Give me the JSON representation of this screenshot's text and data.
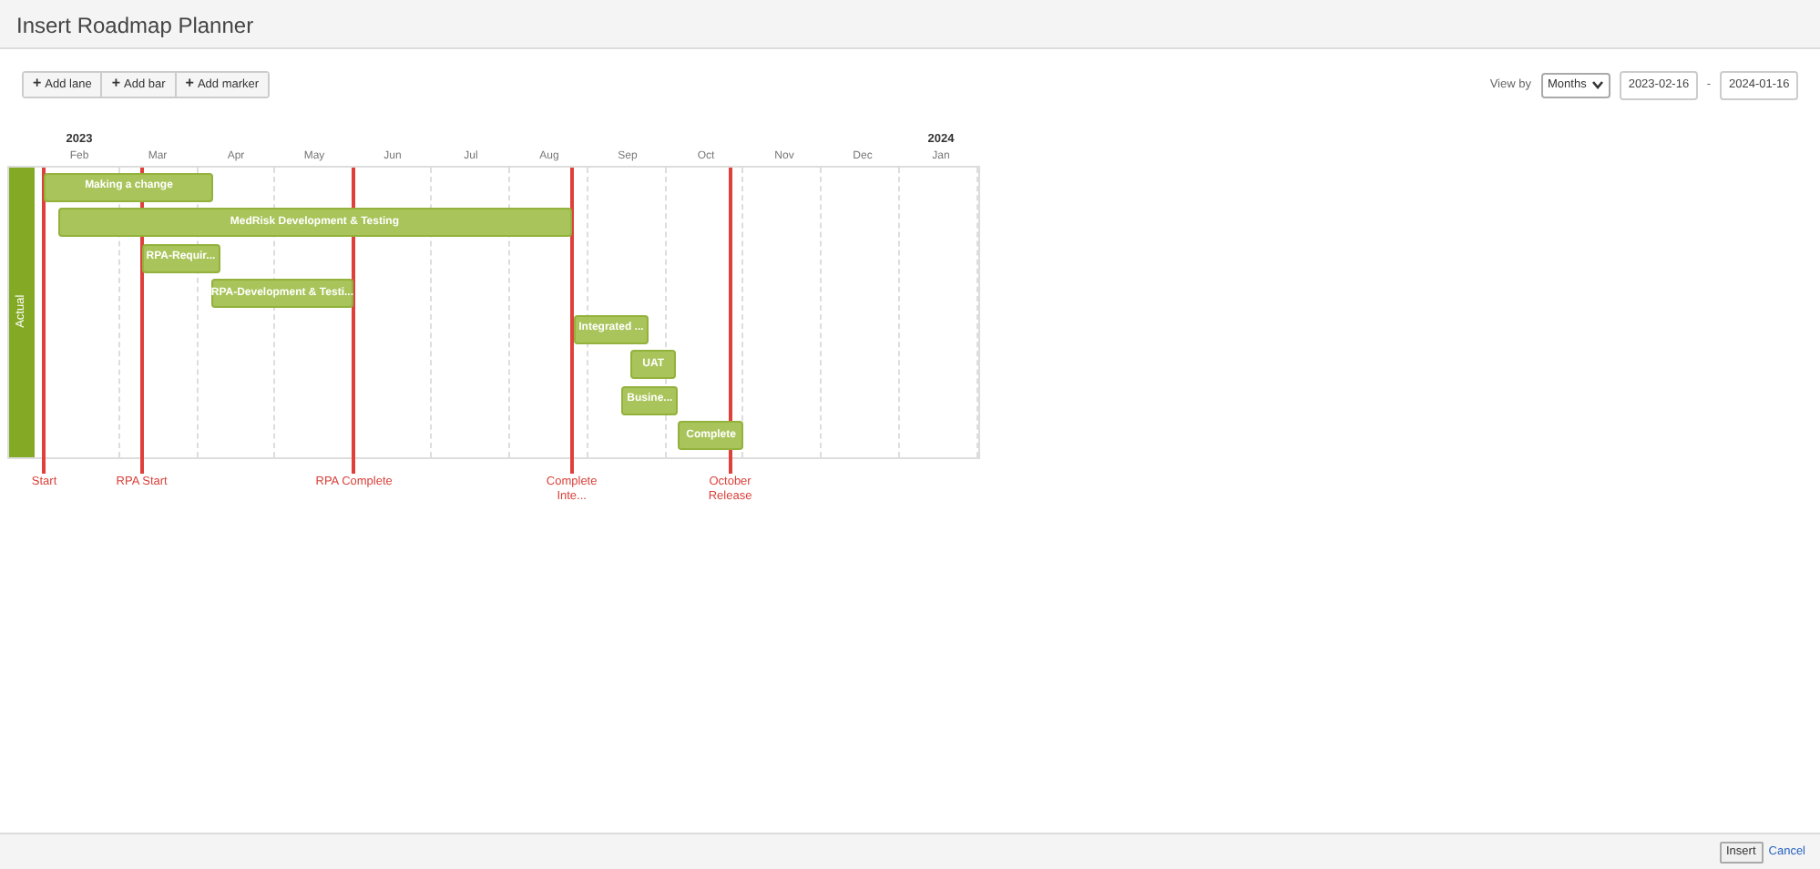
{
  "dialog": {
    "title": "Insert Roadmap Planner"
  },
  "toolbar": {
    "buttons": [
      {
        "icon": "+",
        "label": "Add lane"
      },
      {
        "icon": "+",
        "label": "Add bar"
      },
      {
        "icon": "+",
        "label": "Add marker"
      }
    ]
  },
  "view_by": {
    "label": "View by",
    "selected": "Months",
    "start_date": "2023-02-16",
    "separator": "-",
    "end_date": "2024-01-16"
  },
  "timeline": {
    "months": [
      {
        "year": "2023",
        "label": "Feb"
      },
      {
        "label": "Mar"
      },
      {
        "label": "Apr"
      },
      {
        "label": "May"
      },
      {
        "label": "Jun"
      },
      {
        "label": "Jul"
      },
      {
        "label": "Aug"
      },
      {
        "label": "Sep"
      },
      {
        "label": "Oct"
      },
      {
        "label": "Nov"
      },
      {
        "label": "Dec"
      },
      {
        "year": "2024",
        "label": "Jan"
      }
    ],
    "lanes": [
      {
        "label": "Actual"
      }
    ],
    "bars": [
      {
        "label": "Making a change"
      },
      {
        "label": "MedRisk Development & Testing"
      },
      {
        "label": "RPA-Requir..."
      },
      {
        "label": "RPA-Development & Testi..."
      },
      {
        "label": "Integrated ..."
      },
      {
        "label": "UAT"
      },
      {
        "label": "Busine..."
      },
      {
        "label": "Complete"
      }
    ],
    "markers": [
      {
        "label": "Start"
      },
      {
        "label": "RPA Start"
      },
      {
        "label": "RPA Complete"
      },
      {
        "label": "Complete Inte..."
      },
      {
        "label": "October Release"
      }
    ]
  },
  "footer": {
    "buttons": [
      {
        "label": "Insert",
        "kind": "primary"
      },
      {
        "label": "Cancel",
        "kind": "link"
      }
    ]
  }
}
